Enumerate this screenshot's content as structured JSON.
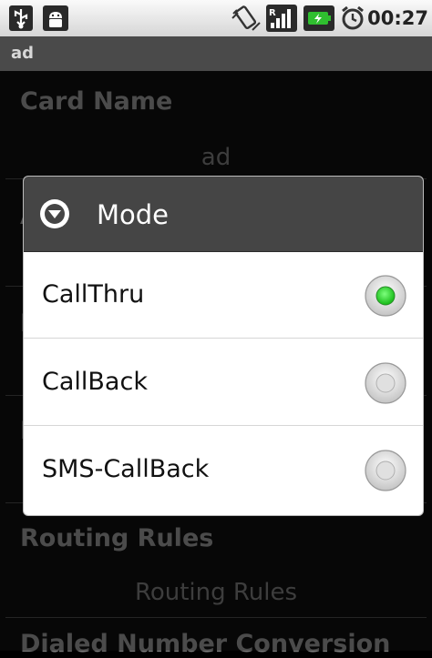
{
  "status_bar": {
    "icons": [
      "usb-icon",
      "android-debug-icon",
      "vibrate-icon",
      "signal-icon",
      "battery-icon",
      "alarm-icon"
    ],
    "time": "00:27"
  },
  "title_bar": {
    "title": "ad"
  },
  "background_prefs": {
    "card_name": {
      "title": "Card Name",
      "summary": "ad"
    },
    "partial_1": "A",
    "partial_2": "I",
    "partial_3": "I",
    "routing_rules": {
      "title": "Routing Rules",
      "summary": "Routing Rules"
    },
    "dialed_number_conversion": {
      "title": "Dialed Number Conversion"
    }
  },
  "dialog": {
    "title": "Mode",
    "options": [
      {
        "label": "CallThru",
        "selected": true
      },
      {
        "label": "CallBack",
        "selected": false
      },
      {
        "label": "SMS-CallBack",
        "selected": false
      }
    ]
  },
  "colors": {
    "radio_selected": "#22cc22",
    "dialog_header": "#454545",
    "title_bar": "#4a4a4a"
  }
}
